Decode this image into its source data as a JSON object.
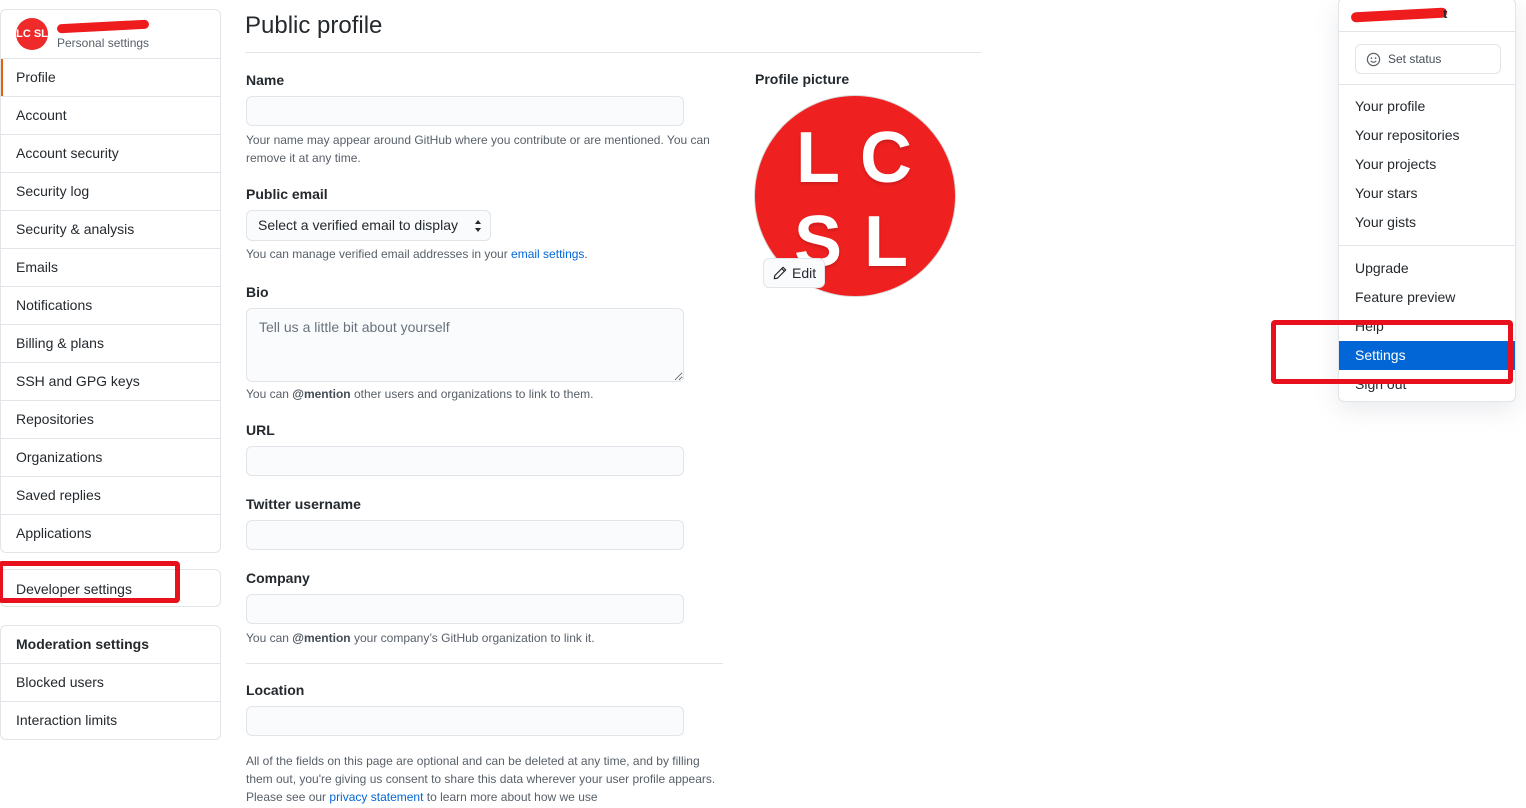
{
  "sidebar": {
    "header": {
      "avatar_text": "LC SL",
      "subtitle": "Personal settings"
    },
    "items": [
      {
        "label": "Profile"
      },
      {
        "label": "Account"
      },
      {
        "label": "Account security"
      },
      {
        "label": "Security log"
      },
      {
        "label": "Security & analysis"
      },
      {
        "label": "Emails"
      },
      {
        "label": "Notifications"
      },
      {
        "label": "Billing & plans"
      },
      {
        "label": "SSH and GPG keys"
      },
      {
        "label": "Repositories"
      },
      {
        "label": "Organizations"
      },
      {
        "label": "Saved replies"
      },
      {
        "label": "Applications"
      }
    ],
    "developer": {
      "label": "Developer settings"
    },
    "moderation": {
      "heading": "Moderation settings",
      "items": [
        {
          "label": "Blocked users"
        },
        {
          "label": "Interaction limits"
        }
      ]
    }
  },
  "main": {
    "title": "Public profile",
    "name": {
      "label": "Name",
      "value": "",
      "note": "Your name may appear around GitHub where you contribute or are mentioned. You can remove it at any time."
    },
    "public_email": {
      "label": "Public email",
      "selected": "Select a verified email to display",
      "note_prefix": "You can manage verified email addresses in your ",
      "note_link": "email settings",
      "note_suffix": "."
    },
    "bio": {
      "label": "Bio",
      "placeholder": "Tell us a little bit about yourself",
      "note_prefix": "You can ",
      "note_mention": "@mention",
      "note_suffix": " other users and organizations to link to them."
    },
    "url": {
      "label": "URL",
      "value": ""
    },
    "twitter": {
      "label": "Twitter username",
      "value": ""
    },
    "company": {
      "label": "Company",
      "value": "",
      "note_prefix": "You can ",
      "note_mention": "@mention",
      "note_suffix": " your company’s GitHub organization to link it."
    },
    "location": {
      "label": "Location",
      "value": ""
    },
    "footer": {
      "prefix": "All of the fields on this page are optional and can be deleted at any time, and by filling them out, you're giving us consent to share this data wherever your user profile appears. Please see our ",
      "link": "privacy statement",
      "suffix": " to learn more about how we use"
    }
  },
  "profile_picture": {
    "label": "Profile picture",
    "letters": [
      "L",
      "C",
      "S",
      "L"
    ],
    "edit_label": "Edit",
    "color": "#ef2020"
  },
  "dropdown": {
    "user_tail": "t",
    "set_status": "Set status",
    "group1": [
      {
        "label": "Your profile"
      },
      {
        "label": "Your repositories"
      },
      {
        "label": "Your projects"
      },
      {
        "label": "Your stars"
      },
      {
        "label": "Your gists"
      }
    ],
    "group2": [
      {
        "label": "Upgrade"
      },
      {
        "label": "Feature preview"
      },
      {
        "label": "Help"
      },
      {
        "label": "Settings"
      },
      {
        "label": "Sign out"
      }
    ],
    "active_color": "#0366d6"
  },
  "highlight_color": "#e8101c"
}
